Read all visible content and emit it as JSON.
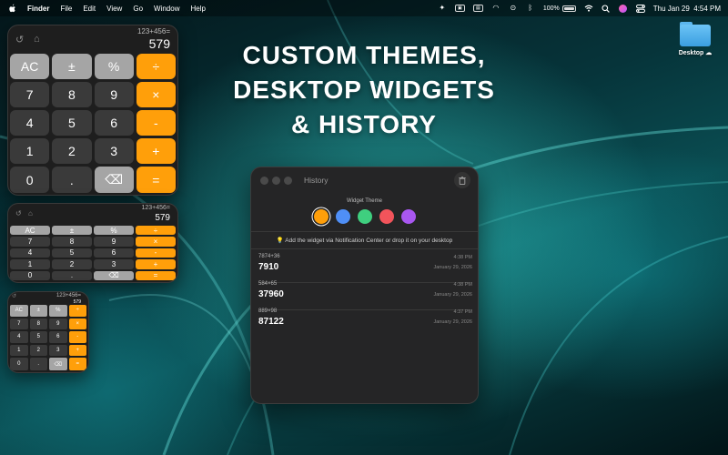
{
  "menubar": {
    "app_name": "Finder",
    "menus": [
      "File",
      "Edit",
      "View",
      "Go",
      "Window",
      "Help"
    ],
    "battery": "100%",
    "clock": "Thu Jan 29  4:54 PM",
    "status_icons": [
      "sparkle-icon",
      "screen-icon",
      "display-icon",
      "airplay-icon",
      "play-icon",
      "bluetooth-icon",
      "battery-icon",
      "wifi-icon",
      "search-icon",
      "user-icon",
      "control-center-icon"
    ]
  },
  "headline": {
    "line1": "CUSTOM THEMES,",
    "line2": "DESKTOP WIDGETS",
    "line3": "& HISTORY"
  },
  "desktop": {
    "folder_label": "Desktop"
  },
  "calculator": {
    "expression": "123+456=",
    "result": "579",
    "keys": [
      {
        "label": "AC",
        "kind": "fn"
      },
      {
        "label": "±",
        "kind": "fn"
      },
      {
        "label": "%",
        "kind": "fn"
      },
      {
        "label": "÷",
        "kind": "op"
      },
      {
        "label": "7",
        "kind": "num"
      },
      {
        "label": "8",
        "kind": "num"
      },
      {
        "label": "9",
        "kind": "num"
      },
      {
        "label": "×",
        "kind": "op"
      },
      {
        "label": "4",
        "kind": "num"
      },
      {
        "label": "5",
        "kind": "num"
      },
      {
        "label": "6",
        "kind": "num"
      },
      {
        "label": "-",
        "kind": "op"
      },
      {
        "label": "1",
        "kind": "num"
      },
      {
        "label": "2",
        "kind": "num"
      },
      {
        "label": "3",
        "kind": "num"
      },
      {
        "label": "+",
        "kind": "op"
      },
      {
        "label": "0",
        "kind": "num"
      },
      {
        "label": ".",
        "kind": "num"
      },
      {
        "label": "⌫",
        "kind": "bs"
      },
      {
        "label": "=",
        "kind": "op"
      }
    ]
  },
  "history_window": {
    "title": "History",
    "theme_label": "Widget Theme",
    "themes": [
      {
        "color": "#ff9f0a",
        "selected": true
      },
      {
        "color": "#4f8ff7",
        "selected": false
      },
      {
        "color": "#3fcf7f",
        "selected": false
      },
      {
        "color": "#f2545b",
        "selected": false
      },
      {
        "color": "#a857f0",
        "selected": false
      }
    ],
    "tip": "💡 Add the widget via Notification Center or drop it on your desktop",
    "entries": [
      {
        "expression": "7874+36",
        "result": "7910",
        "time": "4:38 PM",
        "date": "January 29, 2026"
      },
      {
        "expression": "584×65",
        "result": "37960",
        "time": "4:38 PM",
        "date": "January 29, 2026"
      },
      {
        "expression": "889×98",
        "result": "87122",
        "time": "4:37 PM",
        "date": "January 29, 2026"
      }
    ]
  },
  "colors": {
    "accent_orange": "#ff9f0a",
    "function_key": "#a5a5a5",
    "number_key": "#3a3a3a",
    "wallpaper": "#0a4d52"
  }
}
